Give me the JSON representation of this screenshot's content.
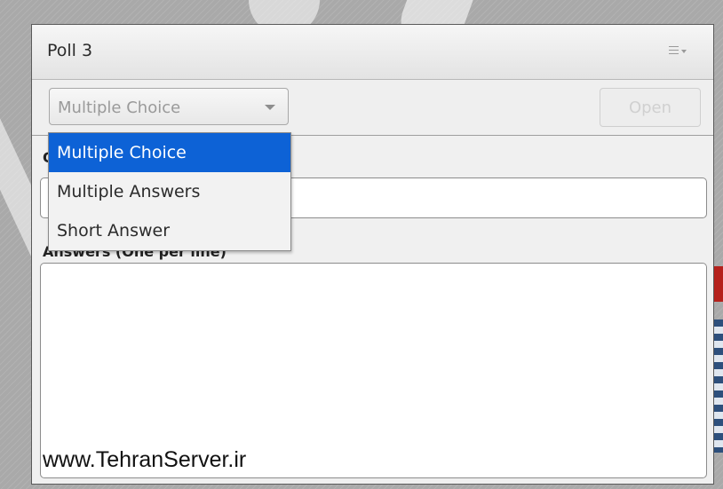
{
  "panel": {
    "title": "Poll 3",
    "menu_icon": "hamburger-menu-icon"
  },
  "toolbar": {
    "question_type": {
      "value": "Multiple Choice",
      "options": [
        "Multiple Choice",
        "Multiple Answers",
        "Short Answer"
      ],
      "selected_index": 0
    },
    "open_label": "Open"
  },
  "form": {
    "question_label": "Q",
    "question_value": "",
    "answers_label": "Answers (One per line)",
    "answers_value": ""
  },
  "watermark_text": "www.TehranServer.ir",
  "colors": {
    "accent": "#0d62d6",
    "panel_bg": "#f0f0f0",
    "background": "#a9a9a9"
  }
}
